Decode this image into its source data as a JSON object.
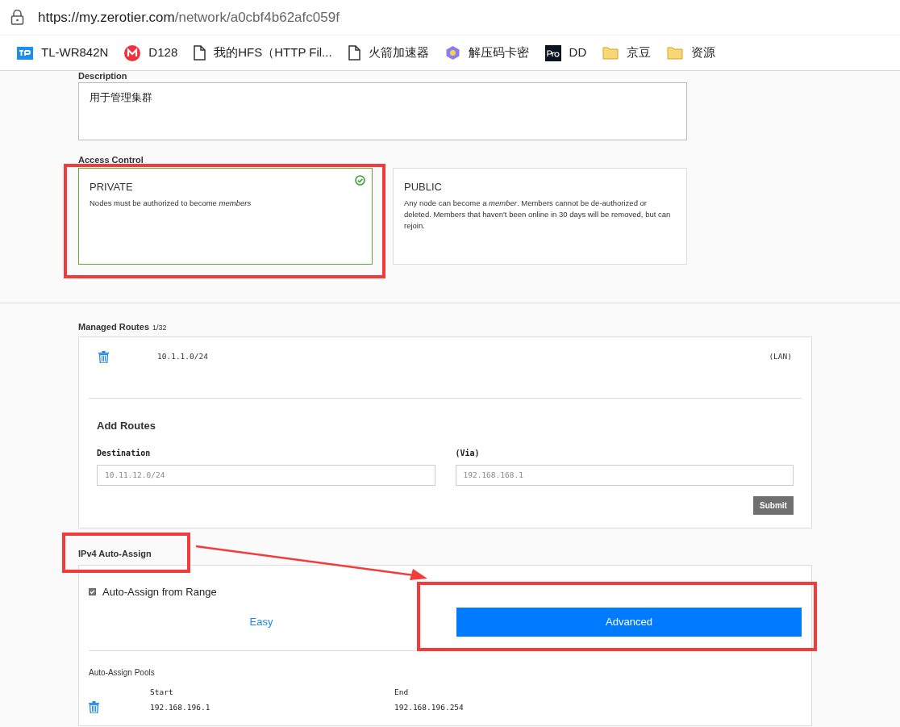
{
  "browser": {
    "url_host": "https://my.zerotier.com",
    "url_path": "/network/a0cbf4b62afc059f",
    "bookmarks": [
      {
        "label": "TL-WR842N",
        "kind": "tp"
      },
      {
        "label": "D128",
        "kind": "m"
      },
      {
        "label": "我的HFS（HTTP Fil...",
        "kind": "page"
      },
      {
        "label": "火箭加速器",
        "kind": "page"
      },
      {
        "label": "解压码卡密",
        "kind": "hex"
      },
      {
        "label": "DD",
        "kind": "pro"
      },
      {
        "label": "京豆",
        "kind": "folder"
      },
      {
        "label": "资源",
        "kind": "folder"
      }
    ]
  },
  "description": {
    "label": "Description",
    "value": "用于管理集群"
  },
  "access_control": {
    "label": "Access Control",
    "options": [
      {
        "title": "PRIVATE",
        "text": "Nodes must be authorized to become *members*",
        "selected": true
      },
      {
        "title": "PUBLIC",
        "text": "Any node can become a *member*. Members cannot be de-authorized or deleted. Members that haven't been online in 30 days will be removed, but can rejoin.",
        "selected": false
      }
    ]
  },
  "managed_routes": {
    "label": "Managed Routes",
    "count": "1/32",
    "routes": [
      {
        "target": "10.1.1.0/24",
        "via": "(LAN)"
      }
    ],
    "add": {
      "title": "Add Routes",
      "destination_label": "Destination",
      "destination_placeholder": "10.11.12.0/24",
      "via_label": "(Via)",
      "via_placeholder": "192.168.168.1",
      "submit": "Submit"
    }
  },
  "ipv4": {
    "label": "IPv4 Auto-Assign",
    "auto_assign": {
      "label": "Auto-Assign from Range",
      "checked": true
    },
    "modes": [
      {
        "label": "Easy",
        "selected": false
      },
      {
        "label": "Advanced",
        "selected": true
      }
    ],
    "pools_label": "Auto-Assign Pools",
    "start_label": "Start",
    "end_label": "End",
    "pools": [
      {
        "start": "192.168.196.1",
        "end": "192.168.196.254"
      }
    ]
  }
}
